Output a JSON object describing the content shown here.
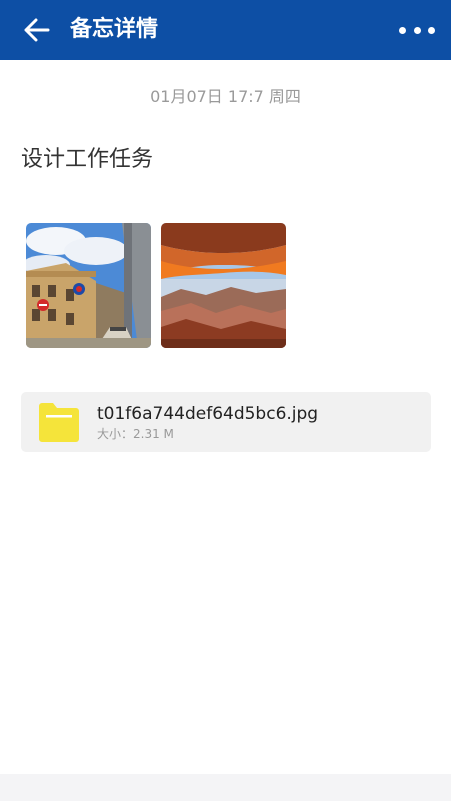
{
  "header": {
    "back_icon": "arrow-left-icon",
    "title": "备忘详情",
    "more_icon": "more-dots-icon",
    "background_color": "#0d4fa5"
  },
  "memo": {
    "timestamp": "01月07日 17:7 周四",
    "title": "设计工作任务",
    "images": [
      {
        "subject": "street-building-photo"
      },
      {
        "subject": "canyon-arch-photo"
      }
    ],
    "attachment": {
      "icon": "folder-icon",
      "file_name": "t01f6a744def64d5bc6.jpg",
      "size_label": "大小：",
      "size_value": "2.31 M"
    }
  }
}
